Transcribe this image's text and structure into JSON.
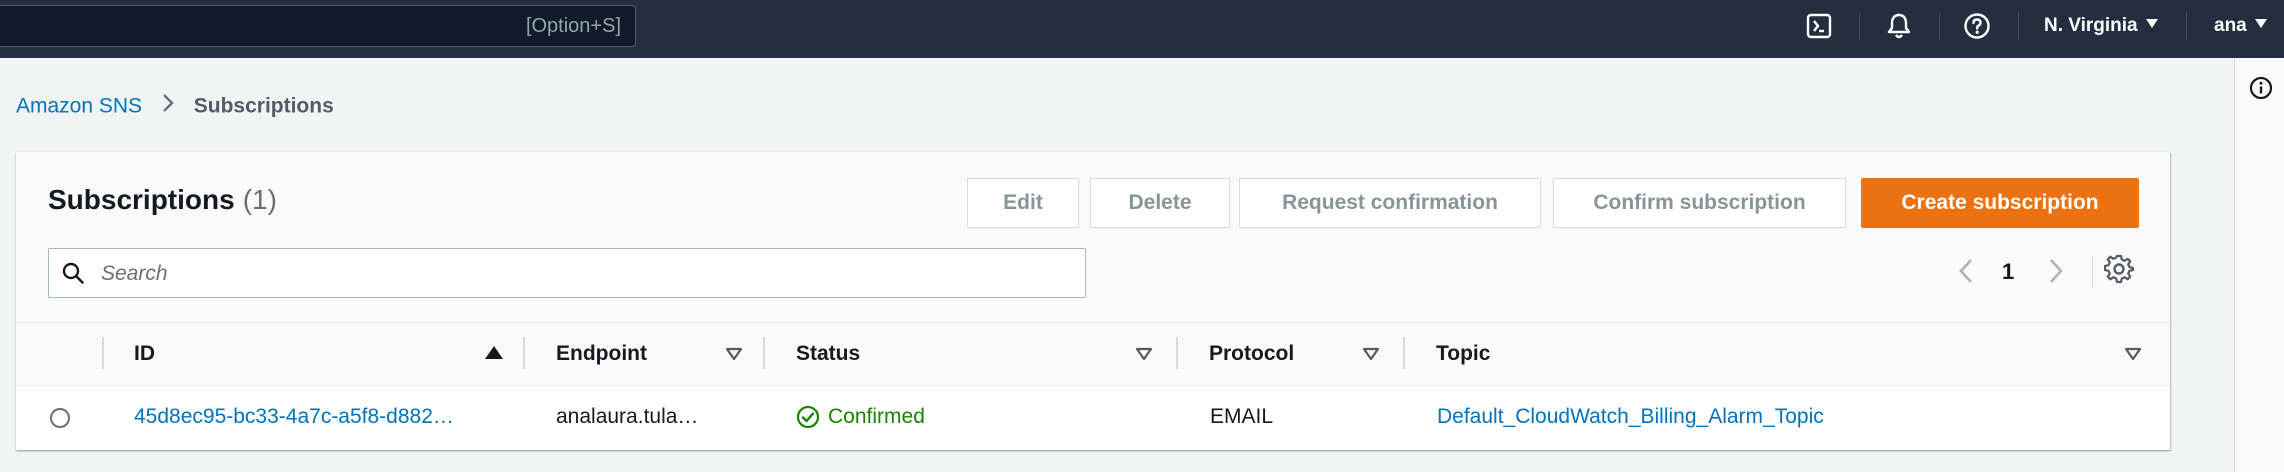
{
  "topbar": {
    "search_shortcut": "[Option+S]",
    "region": "N. Virginia",
    "account": "ana",
    "icons": [
      "cloudshell-icon",
      "notifications-bell-icon",
      "help-icon"
    ]
  },
  "breadcrumb": {
    "service": "Amazon SNS",
    "current": "Subscriptions"
  },
  "panel": {
    "title": "Subscriptions",
    "count": "(1)",
    "buttons": {
      "edit": "Edit",
      "delete": "Delete",
      "request_confirmation": "Request confirmation",
      "confirm_subscription": "Confirm subscription",
      "create_subscription": "Create subscription"
    },
    "search_placeholder": "Search",
    "page": "1"
  },
  "table": {
    "columns": [
      "ID",
      "Endpoint",
      "Status",
      "Protocol",
      "Topic"
    ],
    "rows": [
      {
        "id": "45d8ec95-bc33-4a7c-a5f8-d882…",
        "endpoint": "analaura.tula…",
        "status": "Confirmed",
        "protocol": "EMAIL",
        "topic": "Default_CloudWatch_Billing_Alarm_Topic"
      }
    ]
  },
  "colors": {
    "topbar": "#232f3e",
    "link": "#0073bb",
    "primary": "#ec7211",
    "success": "#1d8102"
  }
}
